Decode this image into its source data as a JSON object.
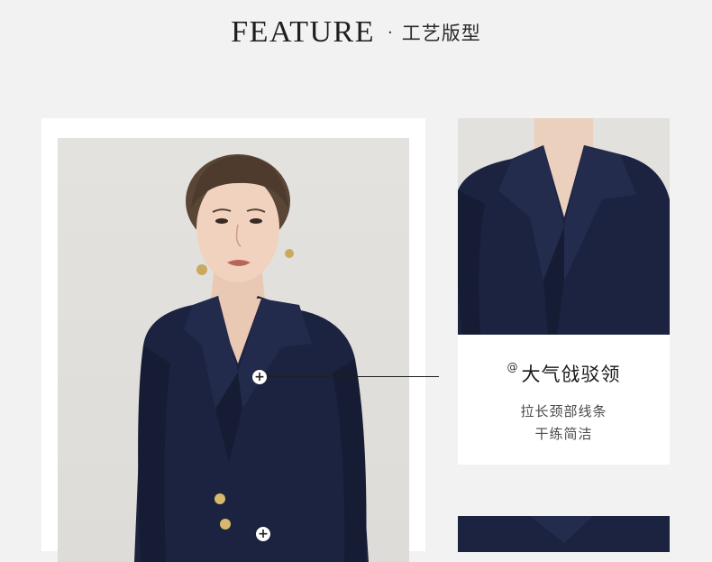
{
  "header": {
    "title": "FEATURE",
    "separator": "·",
    "subtitle": "工艺版型"
  },
  "detail_card": {
    "mark": "@",
    "title": "大气戗驳领",
    "line1": "拉长颈部线条",
    "line2": "干练简洁"
  },
  "hotspots": [
    {
      "symbol": "+"
    },
    {
      "symbol": "+"
    }
  ],
  "colors": {
    "background": "#f2f2f2",
    "jacket_navy": "#1c2340",
    "card": "#ffffff",
    "button_gold": "#d8b86a"
  }
}
